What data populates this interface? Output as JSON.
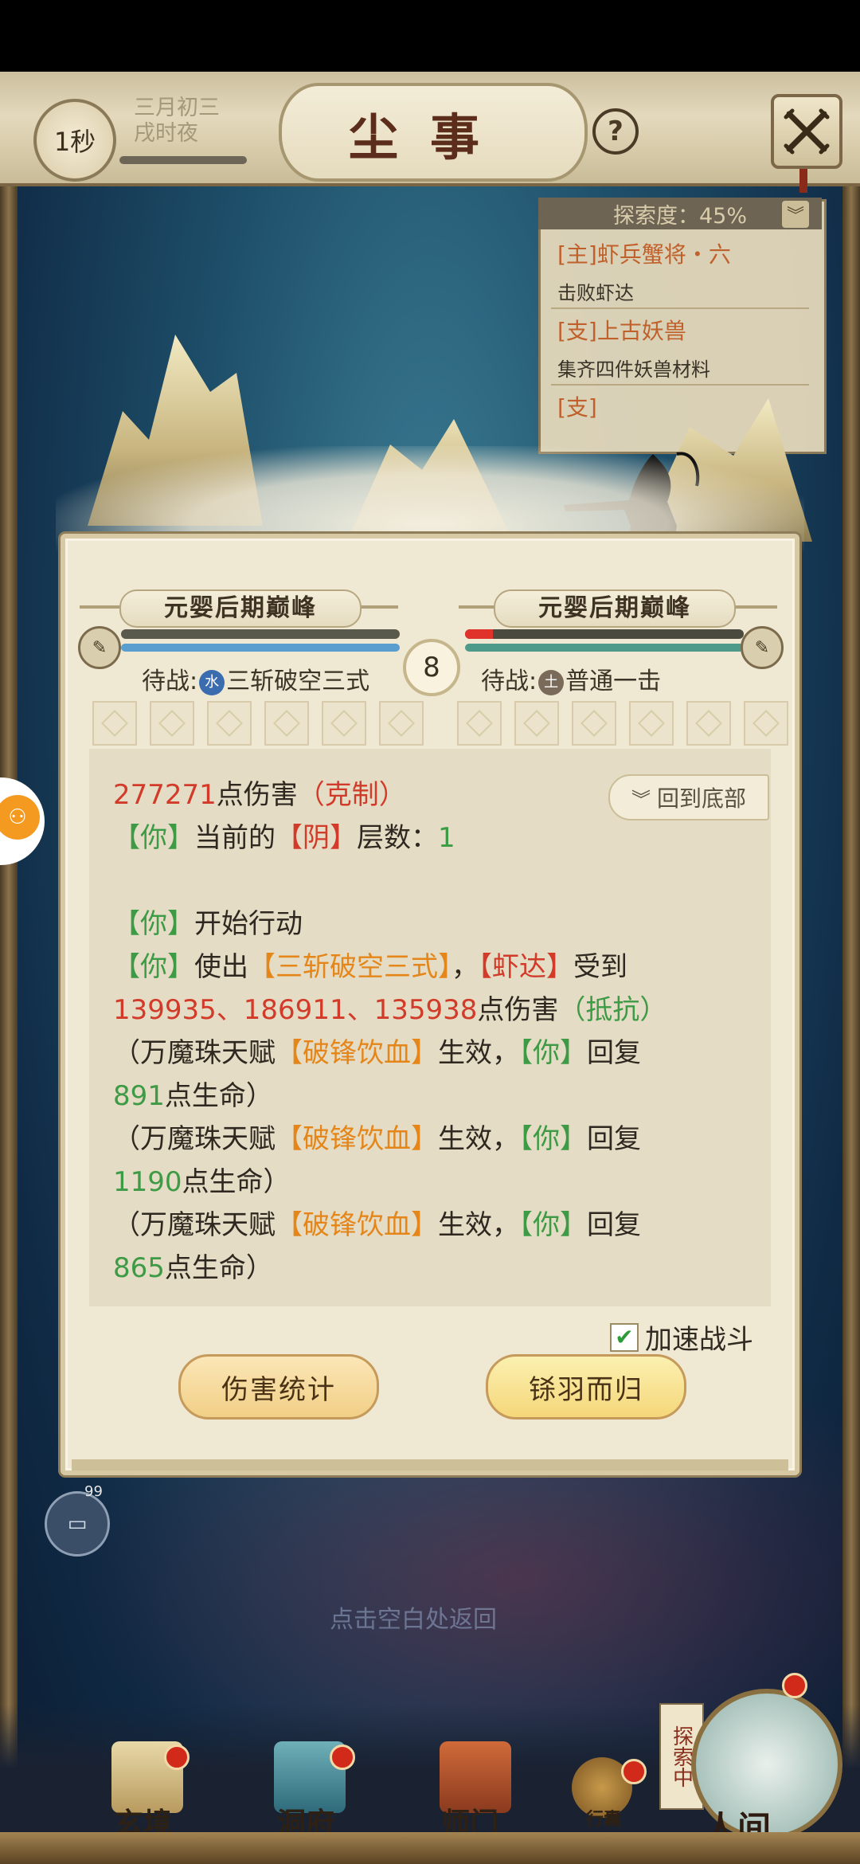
{
  "header": {
    "timer_label": "1秒",
    "date_line1": "三月初三",
    "date_line2": "戌时夜",
    "title": "尘事",
    "help_icon": "?",
    "close_icon": "crossed-weapons-icon"
  },
  "explore": {
    "progress_label": "探索度：45%",
    "progress_percent": 45,
    "quests": [
      {
        "title": "[主]虾兵蟹将・六",
        "desc": "击败虾达"
      },
      {
        "title": "[支]上古妖兽",
        "desc": "集齐四件妖兽材料"
      },
      {
        "title": "[支]",
        "desc": ""
      }
    ]
  },
  "battle": {
    "player": {
      "rank": "元婴后期巅峰",
      "hp_fraction": 1.0,
      "stance_prefix": "待战:",
      "element": "水",
      "skill": "三斩破空三式"
    },
    "enemy": {
      "rank": "元婴后期巅峰",
      "hp_fraction": 0.1,
      "stance_prefix": "待战:",
      "element": "土",
      "skill": "普通一击"
    },
    "round": "8",
    "back_to_bottom": "回到底部"
  },
  "log": {
    "line1": {
      "num": "277271",
      "text": "点伤害",
      "tag": "（克制）"
    },
    "line2": {
      "you": "【你】",
      "a": "当前的",
      "yin": "【阴】",
      "b": "层数：",
      "n": "1"
    },
    "line3": {
      "you": "【你】",
      "text": "开始行动"
    },
    "line4": {
      "you": "【你】",
      "a": "使出",
      "skill": "【三斩破空三式】",
      "comma": "，",
      "enemy": "【虾达】",
      "b": "受到"
    },
    "line5": {
      "nums": "139935、186911、135938",
      "text": "点伤害",
      "tag": "（抵抗）"
    },
    "heal1": {
      "a": "（万魔珠天赋",
      "talent": "【破锋饮血】",
      "b": "生效，",
      "you": "【你】",
      "c": "回复",
      "num": "891",
      "d": "点生命）"
    },
    "heal2": {
      "a": "（万魔珠天赋",
      "talent": "【破锋饮血】",
      "b": "生效，",
      "you": "【你】",
      "c": "回复",
      "num": "1190",
      "d": "点生命）"
    },
    "heal3": {
      "a": "（万魔珠天赋",
      "talent": "【破锋饮血】",
      "b": "生效，",
      "you": "【你】",
      "c": "回复",
      "num": "865",
      "d": "点生命）"
    }
  },
  "controls": {
    "speed_label": "加速战斗",
    "speed_checked": true,
    "damage_stats": "伤害统计",
    "retreat": "铩羽而归"
  },
  "misc": {
    "chat_badge": "99",
    "hint": "点击空白处返回"
  },
  "nav": {
    "items": [
      "玄境",
      "洞府",
      "师门",
      "行囊"
    ],
    "explore_label": "探索中",
    "main_label": "人间"
  }
}
